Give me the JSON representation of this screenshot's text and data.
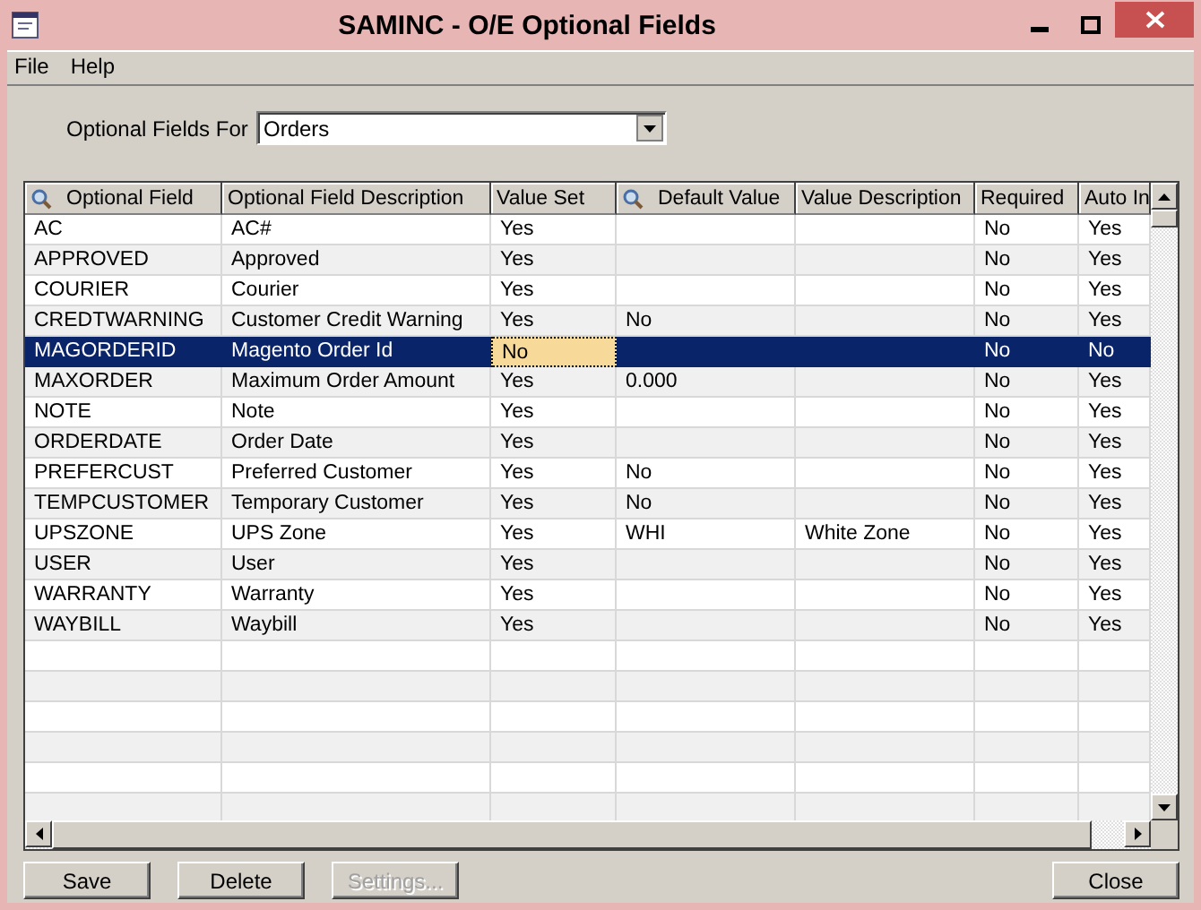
{
  "window": {
    "title": "SAMINC - O/E Optional Fields"
  },
  "menu": [
    "File",
    "Help"
  ],
  "optional_fields_for": {
    "label": "Optional Fields For",
    "value": "Orders"
  },
  "table": {
    "columns": [
      {
        "label": "Optional Field",
        "finder": true
      },
      {
        "label": "Optional Field Description",
        "finder": false
      },
      {
        "label": "Value Set",
        "finder": false
      },
      {
        "label": "Default Value",
        "finder": true
      },
      {
        "label": "Value Description",
        "finder": false
      },
      {
        "label": "Required",
        "finder": false
      },
      {
        "label": "Auto In",
        "finder": false
      }
    ],
    "rows": [
      {
        "cells": [
          "AC",
          "AC#",
          "Yes",
          "",
          "",
          "No",
          "Yes"
        ],
        "selected": false
      },
      {
        "cells": [
          "APPROVED",
          "Approved",
          "Yes",
          "",
          "",
          "No",
          "Yes"
        ],
        "selected": false
      },
      {
        "cells": [
          "COURIER",
          "Courier",
          "Yes",
          "",
          "",
          "No",
          "Yes"
        ],
        "selected": false
      },
      {
        "cells": [
          "CREDTWARNING",
          "Customer Credit Warning",
          "Yes",
          "No",
          "",
          "No",
          "Yes"
        ],
        "selected": false
      },
      {
        "cells": [
          "MAGORDERID",
          "Magento Order Id",
          "No",
          "",
          "",
          "No",
          "No"
        ],
        "selected": true
      },
      {
        "cells": [
          "MAXORDER",
          "Maximum Order Amount",
          "Yes",
          "0.000",
          "",
          "No",
          "Yes"
        ],
        "selected": false
      },
      {
        "cells": [
          "NOTE",
          "Note",
          "Yes",
          "",
          "",
          "No",
          "Yes"
        ],
        "selected": false
      },
      {
        "cells": [
          "ORDERDATE",
          "Order Date",
          "Yes",
          "",
          "",
          "No",
          "Yes"
        ],
        "selected": false
      },
      {
        "cells": [
          "PREFERCUST",
          "Preferred Customer",
          "Yes",
          "No",
          "",
          "No",
          "Yes"
        ],
        "selected": false
      },
      {
        "cells": [
          "TEMPCUSTOMER",
          "Temporary Customer",
          "Yes",
          "No",
          "",
          "No",
          "Yes"
        ],
        "selected": false
      },
      {
        "cells": [
          "UPSZONE",
          "UPS Zone",
          "Yes",
          "WHI",
          "White Zone",
          "No",
          "Yes"
        ],
        "selected": false
      },
      {
        "cells": [
          "USER",
          "User",
          "Yes",
          "",
          "",
          "No",
          "Yes"
        ],
        "selected": false
      },
      {
        "cells": [
          "WARRANTY",
          "Warranty",
          "Yes",
          "",
          "",
          "No",
          "Yes"
        ],
        "selected": false
      },
      {
        "cells": [
          "WAYBILL",
          "Waybill",
          "Yes",
          "",
          "",
          "No",
          "Yes"
        ],
        "selected": false
      }
    ]
  },
  "buttons": [
    {
      "label": "Save",
      "disabled": false
    },
    {
      "label": "Delete",
      "disabled": false
    },
    {
      "label": "Settings...",
      "disabled": true
    }
  ],
  "close_button": {
    "label": "Close"
  }
}
